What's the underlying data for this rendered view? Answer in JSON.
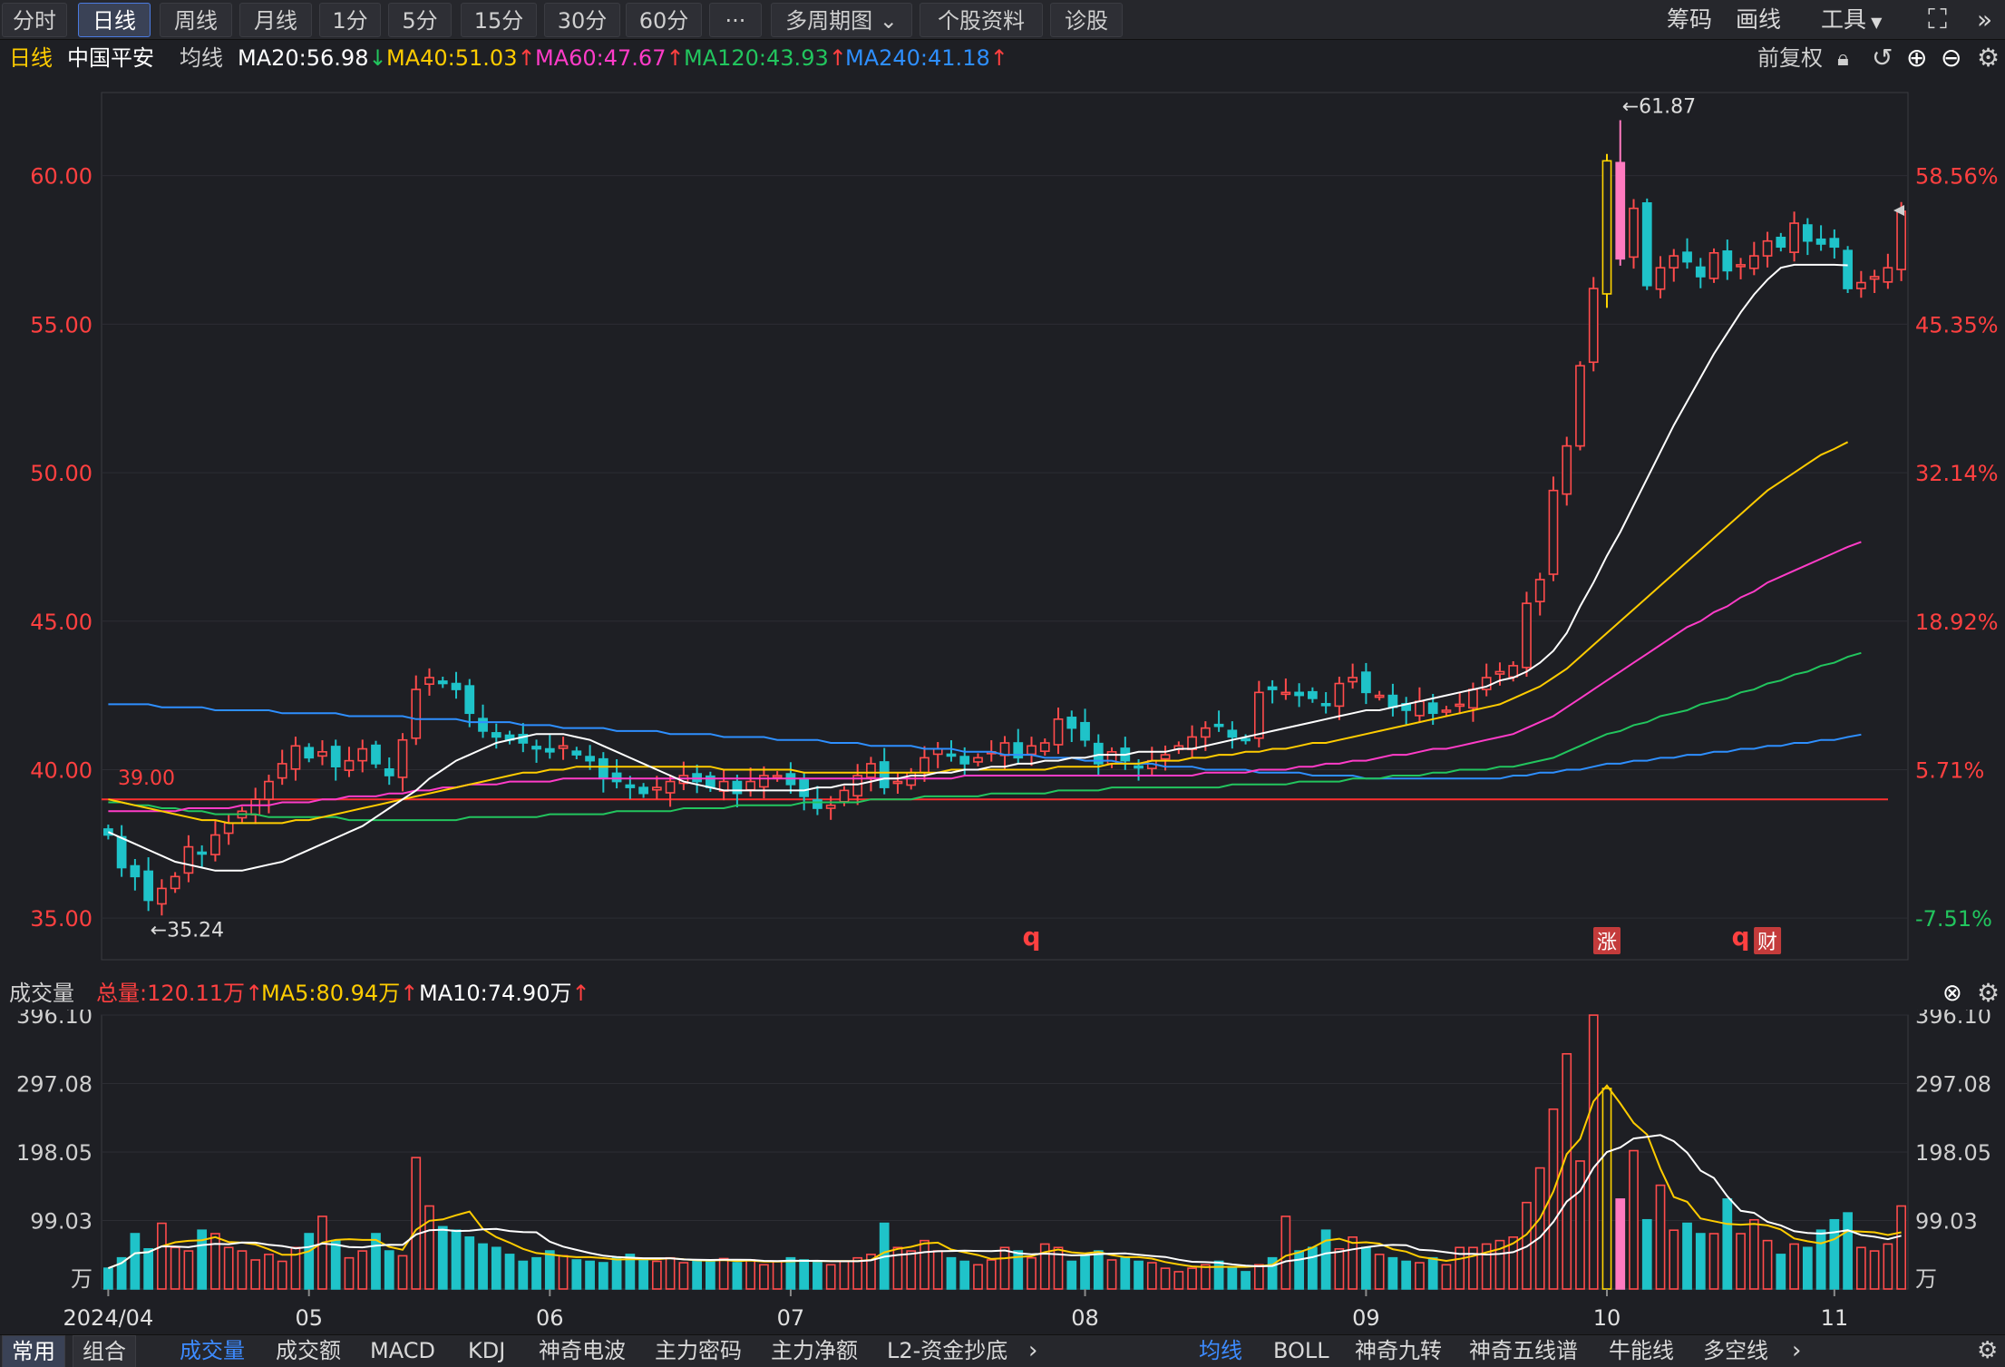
{
  "toolbar": {
    "periods": [
      "分时",
      "日线",
      "周线",
      "月线",
      "1分",
      "5分",
      "15分",
      "30分",
      "60分"
    ],
    "more": "···",
    "multi_period": "多周期图",
    "stock_info": "个股资料",
    "diagnose": "诊股",
    "chips": "筹码",
    "draw": "画线",
    "tools": "工具"
  },
  "indicator": {
    "period": "日线",
    "stock_name": "中国平安",
    "ma_label": "均线",
    "ma20": "MA20:56.98",
    "ma40": "MA40:51.03",
    "ma60": "MA60:47.67",
    "ma120": "MA120:43.93",
    "ma240": "MA240:41.18",
    "adjust": "前复权"
  },
  "colors": {
    "up": "#ff4b4b",
    "down": "#1fc3c9",
    "ma20": "#ffffff",
    "ma40": "#ffcc00",
    "ma60": "#ff3cc8",
    "ma120": "#22c55e",
    "ma240": "#2e8fff",
    "grid": "#2c2d33",
    "axis_left": "#ff4040",
    "axis_right_up": "#ff4040",
    "axis_right_down": "#22c55e"
  },
  "chart_data": {
    "type": "candlestick",
    "y_ticks": [
      "60.00",
      "55.00",
      "50.00",
      "45.00",
      "40.00",
      "35.00"
    ],
    "y_tick_values": [
      60,
      55,
      50,
      45,
      40,
      35
    ],
    "pct_ticks": [
      "58.56%",
      "45.35%",
      "32.14%",
      "18.92%",
      "5.71%",
      "-7.51%"
    ],
    "ylim": [
      33.6,
      62.8
    ],
    "x_ticks": [
      "2024/04",
      "05",
      "06",
      "07",
      "08",
      "09",
      "10",
      "11"
    ],
    "x_tick_index": [
      0,
      15,
      33,
      51,
      73,
      94,
      112,
      129
    ],
    "ref_line": 39.0,
    "ref_label": "39.00",
    "high_label": "←61.87",
    "high_value": 61.87,
    "high_index": 113,
    "low_label": "←35.24",
    "low_value": 35.24,
    "low_index": 3,
    "markers": [
      {
        "text": "q",
        "index": 69
      },
      {
        "text": "涨",
        "index": 112
      },
      {
        "text": "q",
        "index": 122
      },
      {
        "text": "财",
        "index": 124
      }
    ],
    "closes": [
      37.8,
      36.7,
      36.4,
      35.6,
      36.0,
      36.4,
      37.4,
      37.2,
      37.8,
      38.2,
      38.6,
      39.0,
      39.6,
      40.2,
      40.8,
      40.4,
      40.6,
      40.1,
      40.3,
      40.7,
      40.2,
      39.8,
      41.0,
      42.7,
      43.1,
      42.9,
      42.7,
      41.9,
      41.3,
      41.1,
      41.0,
      40.9,
      40.7,
      40.6,
      40.8,
      40.5,
      40.3,
      39.7,
      39.6,
      39.4,
      39.2,
      39.4,
      39.6,
      39.8,
      39.6,
      39.4,
      39.6,
      39.2,
      39.6,
      39.8,
      39.8,
      39.5,
      39.1,
      38.7,
      38.8,
      39.3,
      39.8,
      40.2,
      39.4,
      39.6,
      39.9,
      40.4,
      40.7,
      40.5,
      40.2,
      40.4,
      40.6,
      40.9,
      40.4,
      40.8,
      40.9,
      41.7,
      41.4,
      41.0,
      40.2,
      40.6,
      40.3,
      40.1,
      40.3,
      40.5,
      40.8,
      41.1,
      41.4,
      41.5,
      41.1,
      41.0,
      42.6,
      42.7,
      42.6,
      42.5,
      42.4,
      42.2,
      42.9,
      43.1,
      42.6,
      42.5,
      42.1,
      42.0,
      42.3,
      41.9,
      42.0,
      42.2,
      42.7,
      43.1,
      43.3,
      43.5,
      45.6,
      46.4,
      49.4,
      50.9,
      53.6,
      56.2,
      60.5,
      57.2,
      58.9,
      56.3,
      56.9,
      57.3,
      57.1,
      56.6,
      57.4,
      56.8,
      57.0,
      57.3,
      57.8,
      57.6,
      58.4,
      57.8,
      57.7,
      57.6,
      56.2,
      56.4,
      56.6,
      56.9,
      58.8
    ],
    "volumes": [
      30,
      45,
      80,
      58,
      95,
      60,
      55,
      85,
      80,
      60,
      55,
      42,
      50,
      40,
      60,
      80,
      105,
      70,
      45,
      55,
      80,
      55,
      48,
      190,
      120,
      90,
      85,
      75,
      65,
      60,
      50,
      40,
      45,
      55,
      48,
      42,
      40,
      38,
      45,
      50,
      42,
      40,
      45,
      38,
      42,
      40,
      44,
      38,
      42,
      35,
      40,
      45,
      42,
      40,
      35,
      40,
      45,
      50,
      95,
      60,
      55,
      70,
      55,
      45,
      40,
      35,
      42,
      60,
      55,
      45,
      65,
      60,
      40,
      48,
      55,
      42,
      45,
      40,
      38,
      30,
      25,
      30,
      35,
      40,
      30,
      25,
      35,
      45,
      105,
      55,
      60,
      85,
      58,
      75,
      60,
      50,
      45,
      40,
      38,
      45,
      35,
      60,
      60,
      65,
      70,
      75,
      125,
      175,
      260,
      340,
      185,
      396,
      290,
      130,
      200,
      100,
      150,
      85,
      95,
      80,
      80,
      130,
      80,
      100,
      70,
      50,
      65,
      60,
      85,
      100,
      110,
      60,
      55,
      65,
      120
    ],
    "ma20": [
      37.9,
      37.7,
      37.5,
      37.3,
      37.1,
      36.9,
      36.8,
      36.7,
      36.6,
      36.6,
      36.6,
      36.7,
      36.8,
      36.9,
      37.1,
      37.3,
      37.5,
      37.7,
      37.9,
      38.1,
      38.4,
      38.7,
      39.0,
      39.3,
      39.7,
      40.0,
      40.3,
      40.5,
      40.7,
      40.9,
      41.0,
      41.1,
      41.2,
      41.2,
      41.2,
      41.1,
      41.0,
      40.8,
      40.6,
      40.4,
      40.2,
      40.0,
      39.8,
      39.6,
      39.5,
      39.4,
      39.3,
      39.3,
      39.3,
      39.3,
      39.3,
      39.3,
      39.3,
      39.4,
      39.4,
      39.5,
      39.5,
      39.6,
      39.7,
      39.7,
      39.8,
      39.8,
      39.9,
      39.9,
      40.0,
      40.0,
      40.1,
      40.1,
      40.2,
      40.2,
      40.3,
      40.3,
      40.4,
      40.4,
      40.5,
      40.5,
      40.5,
      40.6,
      40.6,
      40.6,
      40.7,
      40.7,
      40.8,
      40.9,
      41.0,
      41.1,
      41.2,
      41.3,
      41.4,
      41.5,
      41.6,
      41.7,
      41.8,
      41.9,
      42.0,
      42.0,
      42.1,
      42.2,
      42.3,
      42.4,
      42.5,
      42.6,
      42.7,
      42.8,
      43.0,
      43.1,
      43.3,
      43.6,
      44.0,
      44.6,
      45.5,
      46.3,
      47.2,
      48.0,
      48.9,
      49.8,
      50.7,
      51.6,
      52.4,
      53.2,
      54.0,
      54.7,
      55.4,
      56.0,
      56.5,
      56.9,
      57.0,
      57.0,
      57.0,
      57.0,
      56.98
    ],
    "ma40": [
      39.0,
      38.9,
      38.8,
      38.7,
      38.6,
      38.5,
      38.4,
      38.3,
      38.3,
      38.2,
      38.2,
      38.2,
      38.2,
      38.2,
      38.3,
      38.3,
      38.4,
      38.5,
      38.6,
      38.7,
      38.8,
      38.9,
      39.0,
      39.1,
      39.2,
      39.3,
      39.4,
      39.5,
      39.6,
      39.7,
      39.8,
      39.9,
      39.9,
      40.0,
      40.0,
      40.1,
      40.1,
      40.1,
      40.1,
      40.1,
      40.1,
      40.1,
      40.1,
      40.1,
      40.1,
      40.1,
      40.0,
      40.0,
      40.0,
      40.0,
      40.0,
      40.0,
      39.9,
      39.9,
      39.9,
      39.9,
      39.9,
      39.9,
      39.9,
      39.9,
      39.9,
      39.9,
      39.9,
      40.0,
      40.0,
      40.0,
      40.0,
      40.0,
      40.0,
      40.0,
      40.0,
      40.1,
      40.1,
      40.1,
      40.1,
      40.2,
      40.2,
      40.2,
      40.3,
      40.3,
      40.3,
      40.4,
      40.4,
      40.5,
      40.5,
      40.6,
      40.6,
      40.7,
      40.7,
      40.8,
      40.9,
      40.9,
      41.0,
      41.1,
      41.2,
      41.3,
      41.4,
      41.5,
      41.6,
      41.7,
      41.8,
      41.9,
      42.0,
      42.1,
      42.2,
      42.4,
      42.6,
      42.8,
      43.1,
      43.4,
      43.8,
      44.2,
      44.6,
      45.0,
      45.4,
      45.8,
      46.2,
      46.6,
      47.0,
      47.4,
      47.8,
      48.2,
      48.6,
      49.0,
      49.4,
      49.7,
      50.0,
      50.3,
      50.6,
      50.8,
      51.03
    ],
    "ma60": [
      38.6,
      38.6,
      38.6,
      38.6,
      38.6,
      38.6,
      38.7,
      38.7,
      38.7,
      38.7,
      38.8,
      38.8,
      38.8,
      38.9,
      38.9,
      38.9,
      39.0,
      39.0,
      39.1,
      39.1,
      39.1,
      39.2,
      39.2,
      39.3,
      39.3,
      39.4,
      39.4,
      39.5,
      39.5,
      39.5,
      39.6,
      39.6,
      39.6,
      39.6,
      39.7,
      39.7,
      39.7,
      39.7,
      39.7,
      39.7,
      39.7,
      39.7,
      39.7,
      39.7,
      39.7,
      39.7,
      39.7,
      39.7,
      39.7,
      39.7,
      39.7,
      39.7,
      39.7,
      39.7,
      39.7,
      39.7,
      39.7,
      39.7,
      39.7,
      39.7,
      39.7,
      39.7,
      39.7,
      39.7,
      39.8,
      39.8,
      39.8,
      39.8,
      39.8,
      39.8,
      39.8,
      39.8,
      39.8,
      39.8,
      39.8,
      39.8,
      39.8,
      39.8,
      39.8,
      39.8,
      39.8,
      39.8,
      39.9,
      39.9,
      39.9,
      39.9,
      40.0,
      40.0,
      40.0,
      40.1,
      40.1,
      40.2,
      40.2,
      40.3,
      40.3,
      40.4,
      40.5,
      40.5,
      40.6,
      40.7,
      40.7,
      40.8,
      40.9,
      41.0,
      41.1,
      41.2,
      41.4,
      41.6,
      41.8,
      42.1,
      42.4,
      42.7,
      43.0,
      43.3,
      43.6,
      43.9,
      44.2,
      44.5,
      44.8,
      45.0,
      45.3,
      45.5,
      45.8,
      46.0,
      46.3,
      46.5,
      46.7,
      46.9,
      47.1,
      47.3,
      47.5,
      47.67
    ],
    "ma120": [
      38.9,
      38.9,
      38.8,
      38.8,
      38.7,
      38.7,
      38.6,
      38.6,
      38.5,
      38.5,
      38.5,
      38.5,
      38.4,
      38.4,
      38.4,
      38.4,
      38.4,
      38.4,
      38.3,
      38.3,
      38.3,
      38.3,
      38.3,
      38.3,
      38.3,
      38.3,
      38.3,
      38.4,
      38.4,
      38.4,
      38.4,
      38.4,
      38.4,
      38.5,
      38.5,
      38.5,
      38.5,
      38.5,
      38.6,
      38.6,
      38.6,
      38.6,
      38.6,
      38.7,
      38.7,
      38.7,
      38.7,
      38.8,
      38.8,
      38.8,
      38.8,
      38.8,
      38.9,
      38.9,
      38.9,
      38.9,
      38.9,
      39.0,
      39.0,
      39.0,
      39.0,
      39.1,
      39.1,
      39.1,
      39.1,
      39.1,
      39.2,
      39.2,
      39.2,
      39.2,
      39.2,
      39.3,
      39.3,
      39.3,
      39.3,
      39.4,
      39.4,
      39.4,
      39.4,
      39.4,
      39.4,
      39.4,
      39.4,
      39.4,
      39.5,
      39.5,
      39.5,
      39.5,
      39.5,
      39.6,
      39.6,
      39.6,
      39.6,
      39.7,
      39.7,
      39.7,
      39.8,
      39.8,
      39.8,
      39.9,
      39.9,
      40.0,
      40.0,
      40.0,
      40.1,
      40.1,
      40.2,
      40.3,
      40.4,
      40.6,
      40.8,
      41.0,
      41.2,
      41.3,
      41.5,
      41.6,
      41.8,
      41.9,
      42.0,
      42.2,
      42.3,
      42.4,
      42.6,
      42.7,
      42.9,
      43.0,
      43.2,
      43.3,
      43.5,
      43.6,
      43.8,
      43.93
    ],
    "ma240": [
      42.2,
      42.2,
      42.2,
      42.2,
      42.1,
      42.1,
      42.1,
      42.1,
      42.0,
      42.0,
      42.0,
      42.0,
      42.0,
      41.9,
      41.9,
      41.9,
      41.9,
      41.9,
      41.8,
      41.8,
      41.8,
      41.8,
      41.8,
      41.7,
      41.7,
      41.7,
      41.7,
      41.6,
      41.6,
      41.6,
      41.6,
      41.5,
      41.5,
      41.5,
      41.4,
      41.4,
      41.4,
      41.4,
      41.3,
      41.3,
      41.3,
      41.3,
      41.2,
      41.2,
      41.2,
      41.2,
      41.1,
      41.1,
      41.1,
      41.1,
      41.0,
      41.0,
      41.0,
      41.0,
      40.9,
      40.9,
      40.9,
      40.8,
      40.8,
      40.8,
      40.8,
      40.7,
      40.7,
      40.7,
      40.6,
      40.6,
      40.6,
      40.5,
      40.5,
      40.5,
      40.4,
      40.4,
      40.4,
      40.3,
      40.3,
      40.3,
      40.2,
      40.2,
      40.2,
      40.1,
      40.1,
      40.1,
      40.0,
      40.0,
      40.0,
      40.0,
      39.9,
      39.9,
      39.9,
      39.9,
      39.8,
      39.8,
      39.8,
      39.8,
      39.7,
      39.7,
      39.7,
      39.7,
      39.7,
      39.7,
      39.7,
      39.7,
      39.7,
      39.7,
      39.7,
      39.8,
      39.8,
      39.9,
      39.9,
      40.0,
      40.0,
      40.1,
      40.2,
      40.2,
      40.3,
      40.3,
      40.4,
      40.4,
      40.5,
      40.5,
      40.6,
      40.6,
      40.7,
      40.7,
      40.8,
      40.8,
      40.9,
      40.9,
      41.0,
      41.0,
      41.1,
      41.18
    ]
  },
  "volume": {
    "title": "成交量",
    "total": "总量:120.11万",
    "ma5": "MA5:80.94万",
    "ma10": "MA10:74.90万",
    "y_ticks": [
      "396.10",
      "297.08",
      "198.05",
      "99.03",
      "万"
    ],
    "y_tick_values": [
      396.1,
      297.08,
      198.05,
      99.03,
      0
    ],
    "ylim": [
      0,
      396.1
    ]
  },
  "bottom": {
    "left_tabs": [
      "常用",
      "组合"
    ],
    "indicator_tabs": [
      "成交量",
      "成交额",
      "MACD",
      "KDJ",
      "神奇电波",
      "主力密码",
      "主力净额",
      "L2-资金抄底"
    ],
    "right_tabs": [
      "均线",
      "BOLL",
      "神奇九转",
      "神奇五线谱",
      "牛能线",
      "多空线"
    ]
  }
}
